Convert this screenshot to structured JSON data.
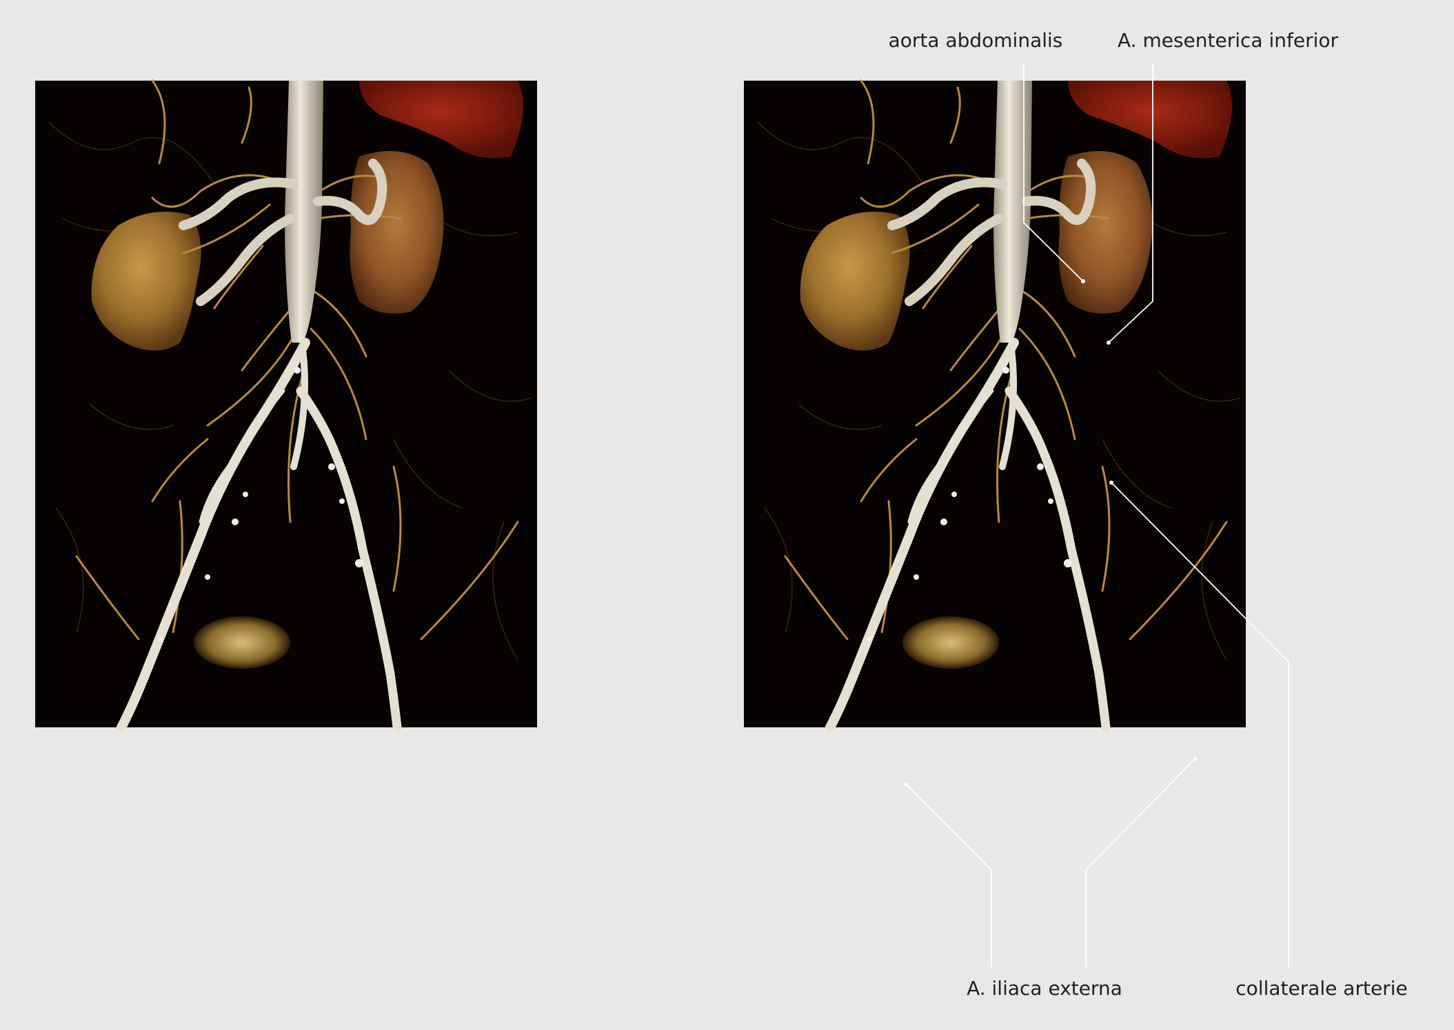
{
  "labels": {
    "aorta": "aorta abdominalis",
    "mesenterica": "A. mesenterica inferior",
    "iliaca": "A. iliaca externa",
    "collaterale": "collaterale arterie"
  },
  "colors": {
    "background": "#e8e8e6",
    "scan_background": "#060302",
    "kidney": "#a8803a",
    "vessel": "#ddd6c6",
    "organ_red": "#8a1a0c",
    "leader_line": "#ffffff",
    "label_text": "#1f1f1f"
  }
}
